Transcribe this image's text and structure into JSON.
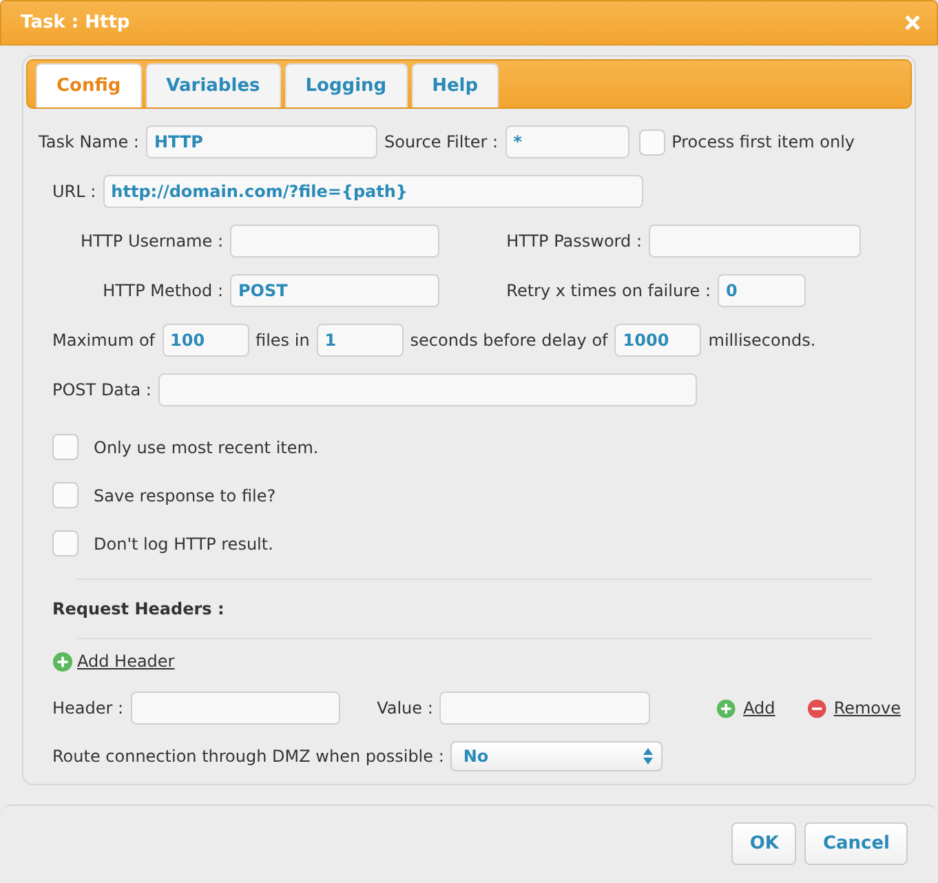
{
  "window": {
    "title": "Task : Http"
  },
  "tabs": [
    {
      "label": "Config",
      "selected": true
    },
    {
      "label": "Variables",
      "selected": false
    },
    {
      "label": "Logging",
      "selected": false
    },
    {
      "label": "Help",
      "selected": false
    }
  ],
  "task_name": {
    "label": "Task Name :",
    "value": "HTTP"
  },
  "source_filter": {
    "label": "Source Filter :",
    "value": "*"
  },
  "process_first": {
    "label": "Process first item only",
    "checked": false
  },
  "url": {
    "label": "URL :",
    "value": "http://domain.com/?file={path}"
  },
  "http_username": {
    "label": "HTTP Username :"
  },
  "http_password": {
    "label": "HTTP Password :"
  },
  "http_method": {
    "label": "HTTP Method :",
    "value": "POST"
  },
  "retry": {
    "label": "Retry x times on failure :",
    "value": "0"
  },
  "rate": [
    {
      "kind": "text",
      "text": "Maximum of"
    },
    {
      "kind": "input",
      "value": "100"
    },
    {
      "kind": "text",
      "text": "files in"
    },
    {
      "kind": "input",
      "value": "1"
    },
    {
      "kind": "text",
      "text": "seconds before delay of"
    },
    {
      "kind": "input",
      "value": "1000"
    },
    {
      "kind": "text",
      "text": "milliseconds."
    }
  ],
  "post_data": {
    "label": "POST Data :"
  },
  "options": [
    {
      "label": "Only use most recent item.",
      "checked": false
    },
    {
      "label": "Save response to file?",
      "checked": false
    },
    {
      "label": "Don't log HTTP result.",
      "checked": false
    }
  ],
  "request_headers": {
    "title": "Request Headers :",
    "add_header": "Add Header",
    "header_label": "Header :",
    "value_label": "Value :",
    "add": "Add",
    "remove": "Remove"
  },
  "dmz": {
    "label": "Route connection through DMZ when possible :",
    "value": "No"
  },
  "buttons": [
    "OK",
    "Cancel"
  ]
}
